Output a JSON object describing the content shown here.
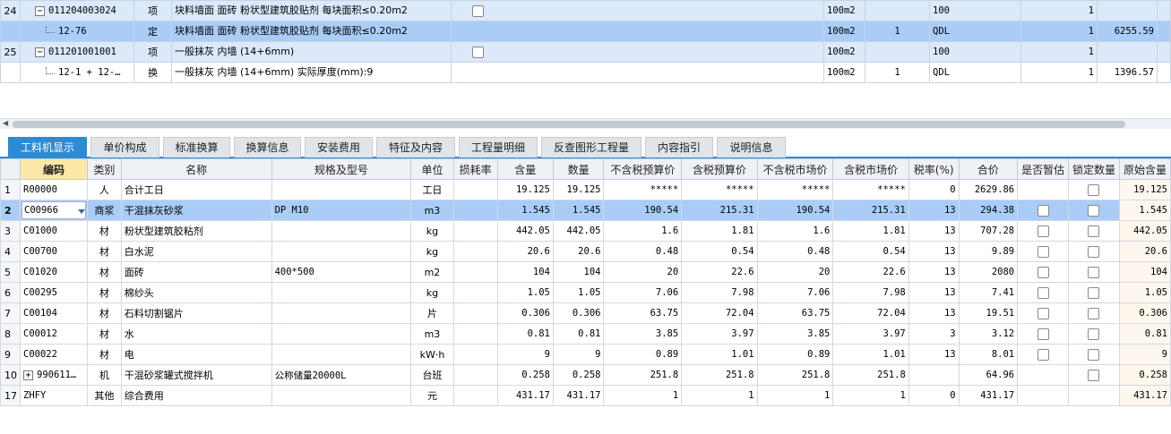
{
  "top_table": {
    "rows": [
      {
        "no": "24",
        "code": "011204003024",
        "tree": "minus",
        "type": "项",
        "name": "块料墙面 面砖 粉状型建筑胶贴剂 每块面积≤0.20m2",
        "unit": "100m2",
        "qty": "",
        "b1": "100",
        "one": "1",
        "price": "",
        "check": true,
        "style": "hl"
      },
      {
        "no": "",
        "code": "12-76",
        "tree": "line",
        "type": "定",
        "name": "块料墙面 面砖 粉状型建筑胶贴剂 每块面积≤0.20m2",
        "unit": "100m2",
        "qty": "1",
        "b1": "QDL",
        "one": "1",
        "price": "6255.59",
        "check": false,
        "style": "sel"
      },
      {
        "no": "25",
        "code": "011201001001",
        "tree": "minus",
        "type": "项",
        "name": "一般抹灰 内墙 (14+6mm)",
        "unit": "100m2",
        "qty": "",
        "b1": "100",
        "one": "1",
        "price": "",
        "check": true,
        "style": "hl"
      },
      {
        "no": "",
        "code": "12-1 + 12-…",
        "tree": "line",
        "type": "换",
        "name": "一般抹灰 内墙 (14+6mm) 实际厚度(mm):9",
        "unit": "100m2",
        "qty": "1",
        "b1": "QDL",
        "one": "1",
        "price": "1396.57",
        "check": false,
        "style": "plain"
      }
    ]
  },
  "tabs": [
    "工料机显示",
    "单价构成",
    "标准换算",
    "换算信息",
    "安装费用",
    "特征及内容",
    "工程量明细",
    "反查图形工程量",
    "内容指引",
    "说明信息"
  ],
  "active_tab": 0,
  "bottom_table": {
    "headers": [
      "编码",
      "类别",
      "名称",
      "规格及型号",
      "单位",
      "损耗率",
      "含量",
      "数量",
      "不含税预算价",
      "含税预算价",
      "不含税市场价",
      "含税市场价",
      "税率(%)",
      "合价",
      "是否暂估",
      "锁定数量",
      "原始含量"
    ],
    "rows": [
      {
        "rn": "1",
        "code": "R00000",
        "cat": "人",
        "name": "合计工日",
        "spec": "",
        "unit": "工日",
        "loss": "",
        "content": "19.125",
        "qty": "19.125",
        "p1": "*****",
        "p2": "*****",
        "p3": "*****",
        "p4": "*****",
        "tax": "0",
        "total": "2629.86",
        "est": false,
        "lock": true,
        "orig": "19.125"
      },
      {
        "rn": "2",
        "code": "C00966",
        "cat": "商浆",
        "name": "干混抹灰砂浆",
        "spec": "DP M10",
        "unit": "m3",
        "loss": "",
        "content": "1.545",
        "qty": "1.545",
        "p1": "190.54",
        "p2": "215.31",
        "p3": "190.54",
        "p4": "215.31",
        "tax": "13",
        "total": "294.38",
        "est": true,
        "lock": true,
        "orig": "1.545",
        "sel": true
      },
      {
        "rn": "3",
        "code": "C01000",
        "cat": "材",
        "name": "粉状型建筑胶粘剂",
        "spec": "",
        "unit": "kg",
        "loss": "",
        "content": "442.05",
        "qty": "442.05",
        "p1": "1.6",
        "p2": "1.81",
        "p3": "1.6",
        "p4": "1.81",
        "tax": "13",
        "total": "707.28",
        "est": true,
        "lock": true,
        "orig": "442.05"
      },
      {
        "rn": "4",
        "code": "C00700",
        "cat": "材",
        "name": "白水泥",
        "spec": "",
        "unit": "kg",
        "loss": "",
        "content": "20.6",
        "qty": "20.6",
        "p1": "0.48",
        "p2": "0.54",
        "p3": "0.48",
        "p4": "0.54",
        "tax": "13",
        "total": "9.89",
        "est": true,
        "lock": true,
        "orig": "20.6"
      },
      {
        "rn": "5",
        "code": "C01020",
        "cat": "材",
        "name": "面砖",
        "spec": "400*500",
        "unit": "m2",
        "loss": "",
        "content": "104",
        "qty": "104",
        "p1": "20",
        "p2": "22.6",
        "p3": "20",
        "p4": "22.6",
        "tax": "13",
        "total": "2080",
        "est": true,
        "lock": true,
        "orig": "104"
      },
      {
        "rn": "6",
        "code": "C00295",
        "cat": "材",
        "name": "棉纱头",
        "spec": "",
        "unit": "kg",
        "loss": "",
        "content": "1.05",
        "qty": "1.05",
        "p1": "7.06",
        "p2": "7.98",
        "p3": "7.06",
        "p4": "7.98",
        "tax": "13",
        "total": "7.41",
        "est": true,
        "lock": true,
        "orig": "1.05"
      },
      {
        "rn": "7",
        "code": "C00104",
        "cat": "材",
        "name": "石料切割锯片",
        "spec": "",
        "unit": "片",
        "loss": "",
        "content": "0.306",
        "qty": "0.306",
        "p1": "63.75",
        "p2": "72.04",
        "p3": "63.75",
        "p4": "72.04",
        "tax": "13",
        "total": "19.51",
        "est": true,
        "lock": true,
        "orig": "0.306"
      },
      {
        "rn": "8",
        "code": "C00012",
        "cat": "材",
        "name": "水",
        "spec": "",
        "unit": "m3",
        "loss": "",
        "content": "0.81",
        "qty": "0.81",
        "p1": "3.85",
        "p2": "3.97",
        "p3": "3.85",
        "p4": "3.97",
        "tax": "3",
        "total": "3.12",
        "est": true,
        "lock": true,
        "orig": "0.81"
      },
      {
        "rn": "9",
        "code": "C00022",
        "cat": "材",
        "name": "电",
        "spec": "",
        "unit": "kW·h",
        "loss": "",
        "content": "9",
        "qty": "9",
        "p1": "0.89",
        "p2": "1.01",
        "p3": "0.89",
        "p4": "1.01",
        "tax": "13",
        "total": "8.01",
        "est": true,
        "lock": true,
        "orig": "9"
      },
      {
        "rn": "10",
        "code": "990611…",
        "cat": "机",
        "name": "干混砂浆罐式搅拌机",
        "spec": "公称储量20000L",
        "unit": "台班",
        "loss": "",
        "content": "0.258",
        "qty": "0.258",
        "p1": "251.8",
        "p2": "251.8",
        "p3": "251.8",
        "p4": "251.8",
        "tax": "",
        "total": "64.96",
        "est": false,
        "lock": true,
        "orig": "0.258",
        "expand": true
      },
      {
        "rn": "17",
        "code": "ZHFY",
        "cat": "其他",
        "name": "综合费用",
        "spec": "",
        "unit": "元",
        "loss": "",
        "content": "431.17",
        "qty": "431.17",
        "p1": "1",
        "p2": "1",
        "p3": "1",
        "p4": "1",
        "tax": "0",
        "total": "431.17",
        "est": false,
        "lock": false,
        "orig": "431.17"
      }
    ]
  },
  "colors": {
    "tab_active": "#2d8bd5",
    "row_selected": "#a9cdf7",
    "row_highlight": "#dce9fb",
    "header_highlight": "#fbe8a6"
  }
}
